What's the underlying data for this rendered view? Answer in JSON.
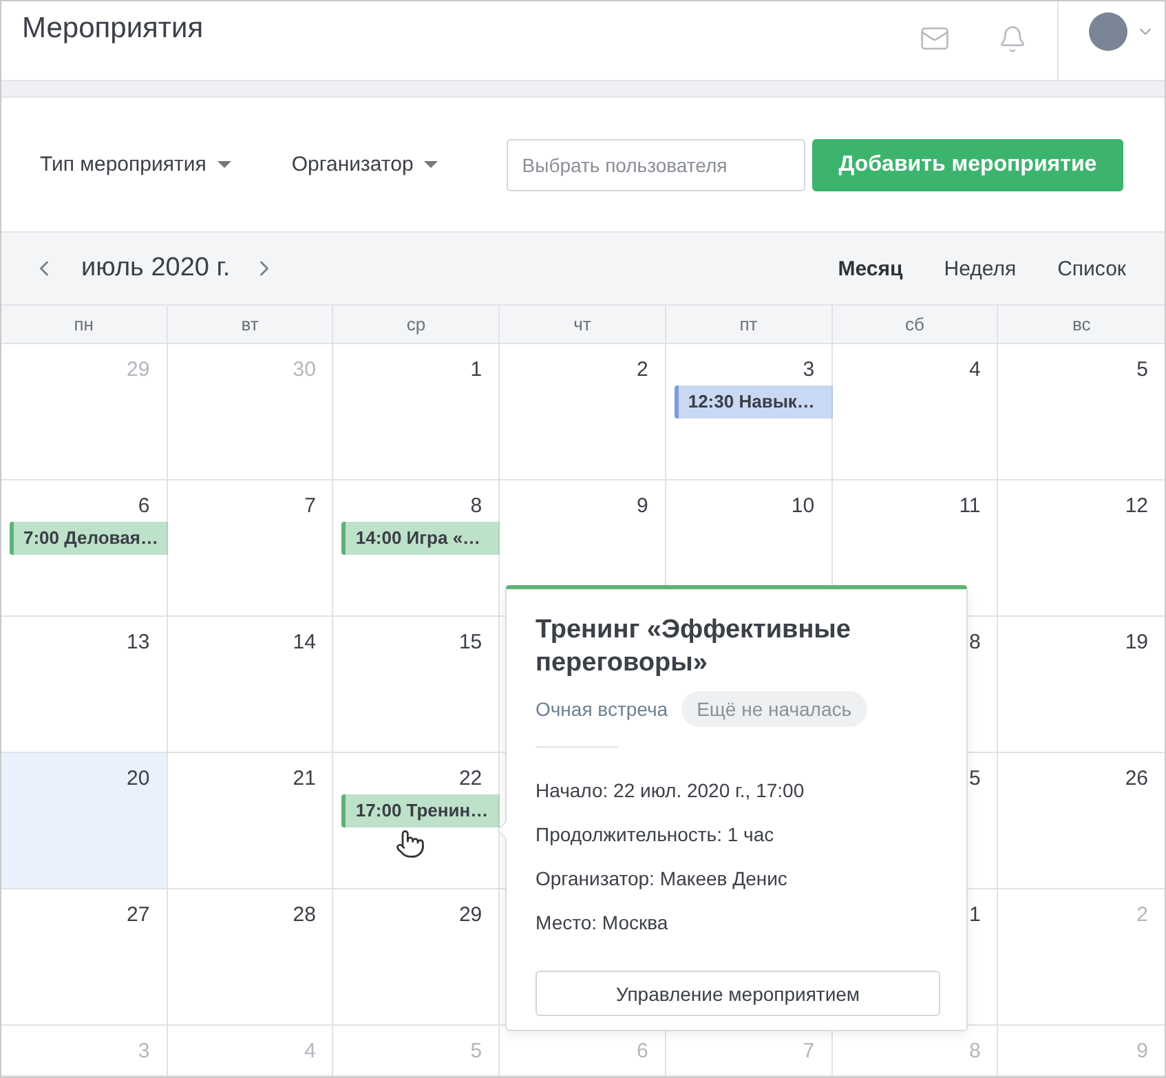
{
  "header": {
    "title": "Мероприятия"
  },
  "filters": {
    "dropdowns": [
      "Тип мероприятия",
      "Организатор"
    ],
    "user_field": {
      "placeholder": "Выбрать пользователя"
    },
    "add_button": "Добавить мероприятие"
  },
  "calendar": {
    "month": "июль 2020 г.",
    "views": [
      {
        "label": "Месяц",
        "selected": true
      },
      {
        "label": "Неделя",
        "selected": false
      },
      {
        "label": "Список",
        "selected": false
      }
    ],
    "weekdays": [
      "пн",
      "вт",
      "ср",
      "чт",
      "пт",
      "сб",
      "вс"
    ],
    "weeks": [
      {
        "days": [
          {
            "day": "29",
            "muted": true,
            "today": false
          },
          {
            "day": "30",
            "muted": true,
            "today": false
          },
          {
            "day": "1",
            "muted": false,
            "today": false
          },
          {
            "day": "2",
            "muted": false,
            "today": false
          },
          {
            "day": "3",
            "muted": false,
            "today": false,
            "events": [
              {
                "text": "12:30 Навык…",
                "color": "#7b9fe0"
              }
            ]
          },
          {
            "day": "4",
            "muted": false,
            "today": false
          },
          {
            "day": "5",
            "muted": false,
            "today": false
          }
        ]
      },
      {
        "days": [
          {
            "day": "6",
            "muted": false,
            "today": false,
            "events": [
              {
                "text": "7:00 Деловая…",
                "color": "#5cb377"
              }
            ]
          },
          {
            "day": "7",
            "muted": false,
            "today": false
          },
          {
            "day": "8",
            "muted": false,
            "today": false,
            "events": [
              {
                "text": "14:00 Игра «…",
                "color": "#5cb377"
              }
            ]
          },
          {
            "day": "9",
            "muted": false,
            "today": false
          },
          {
            "day": "10",
            "muted": false,
            "today": false
          },
          {
            "day": "11",
            "muted": false,
            "today": false
          },
          {
            "day": "12",
            "muted": false,
            "today": false
          }
        ]
      },
      {
        "days": [
          {
            "day": "13",
            "muted": false,
            "today": false
          },
          {
            "day": "14",
            "muted": false,
            "today": false
          },
          {
            "day": "15",
            "muted": false,
            "today": false
          }
        ],
        "days_right": [
          {
            "day": "8",
            "muted": false,
            "today": false
          },
          {
            "day": "19",
            "muted": false,
            "today": false
          }
        ]
      },
      {
        "days": [
          {
            "day": "20",
            "muted": false,
            "today": true
          },
          {
            "day": "21",
            "muted": false,
            "today": false
          },
          {
            "day": "22",
            "muted": false,
            "today": false,
            "events": [
              {
                "text": "17:00 Тренин…",
                "color": "#5cb377"
              }
            ]
          }
        ],
        "days_right": [
          {
            "day": "5",
            "muted": false,
            "today": false
          },
          {
            "day": "26",
            "muted": false,
            "today": false
          }
        ]
      },
      {
        "days": [
          {
            "day": "27",
            "muted": false,
            "today": false
          },
          {
            "day": "28",
            "muted": false,
            "today": false
          },
          {
            "day": "29",
            "muted": false,
            "today": false
          }
        ],
        "days_right": [
          {
            "day": "1",
            "muted": false,
            "today": false
          },
          {
            "day": "2",
            "muted": true,
            "today": false
          }
        ]
      },
      {
        "days": [
          {
            "day": "3",
            "muted": true,
            "today": false
          },
          {
            "day": "4",
            "muted": true,
            "today": false
          },
          {
            "day": "5",
            "muted": true,
            "today": false
          },
          {
            "day": "6",
            "muted": true,
            "today": false
          },
          {
            "day": "7",
            "muted": true,
            "today": false
          },
          {
            "day": "8",
            "muted": true,
            "today": false
          },
          {
            "day": "9",
            "muted": true,
            "today": false
          }
        ]
      }
    ]
  },
  "popup": {
    "title": "Тренинг «Эффективные переговоры»",
    "type": "Очная встреча",
    "status": "Ещё не началась",
    "details": [
      "Начало: 22 июл. 2020 г., 17:00",
      "Продолжительность: 1 час",
      "Организатор: Макеев Денис",
      "Место: Москва"
    ],
    "button": "Управление мероприятием"
  }
}
